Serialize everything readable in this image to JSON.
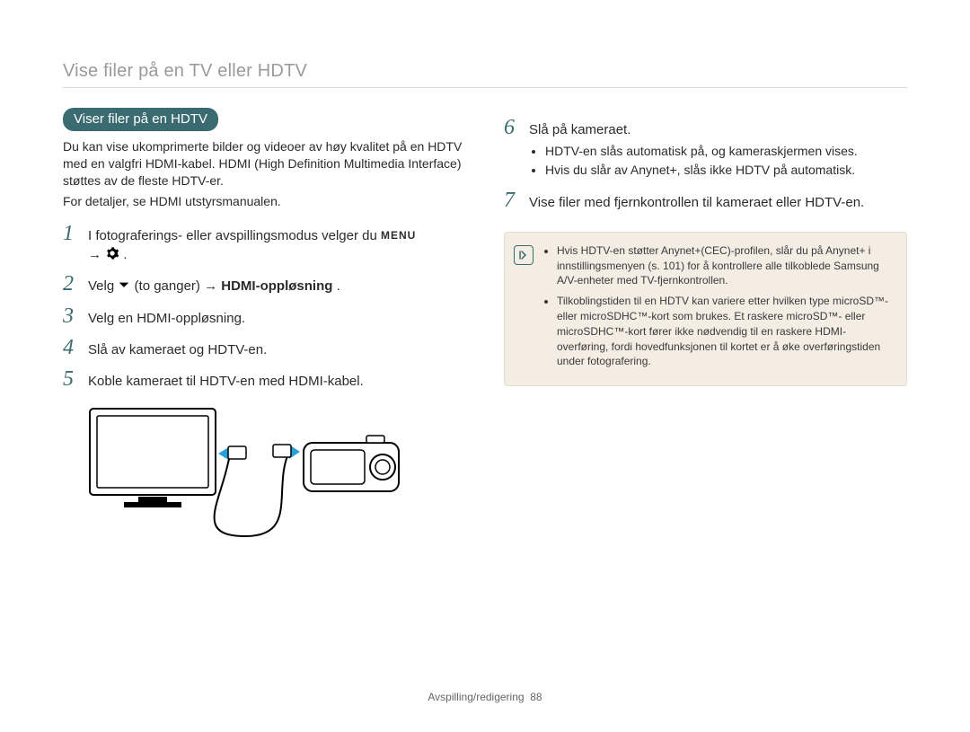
{
  "page": {
    "running_title": "Vise filer på en TV eller HDTV",
    "footer_section": "Avspilling/redigering",
    "footer_page": "88"
  },
  "left": {
    "heading": "Viser filer på en HDTV",
    "intro": "Du kan vise ukomprimerte bilder og videoer av høy kvalitet på en HDTV med en valgfri HDMI-kabel. HDMI (High Definition Multimedia Interface) støttes av de fleste HDTV-er.",
    "detail": "For detaljer, se HDMI utstyrsmanualen.",
    "steps": {
      "1": {
        "pre": "I fotograferings- eller avspillingsmodus velger du ",
        "menu": "MENU",
        "arrow": "→",
        "post": "."
      },
      "2": {
        "pre": "Velg ",
        "mid": " (to ganger) → ",
        "opt": "HDMI-oppløsning",
        "post": " ."
      },
      "3": "Velg en HDMI-oppløsning.",
      "4": "Slå av kameraet og HDTV-en.",
      "5": "Koble kameraet til HDTV-en med HDMI-kabel."
    }
  },
  "right": {
    "steps": {
      "6": {
        "text": "Slå på kameraet.",
        "bullets": [
          "HDTV-en slås automatisk på, og kameraskjermen vises.",
          "Hvis du slår av Anynet+, slås ikke HDTV på automatisk."
        ]
      },
      "7": "Vise filer med fjernkontrollen til kameraet eller HDTV-en."
    },
    "note": {
      "icon_label": "note-icon",
      "items": [
        "Hvis HDTV-en støtter Anynet+(CEC)-profilen, slår du på Anynet+ i innstillingsmenyen (s. 101) for å kontrollere alle tilkoblede Samsung A/V-enheter med TV-fjernkontrollen.",
        "Tilkoblingstiden til en HDTV kan variere etter hvilken type microSD™- eller microSDHC™-kort som brukes. Et raskere microSD™- eller microSDHC™-kort fører ikke nødvendig til en raskere HDMI-overføring, fordi hovedfunksjonen til kortet er å øke overføringstiden under fotografering."
      ]
    }
  },
  "icons": {
    "down_arrow": "❤",
    "right_arrow": "→",
    "gear": "gear-icon",
    "menu": "menu-icon",
    "note": "info-icon"
  }
}
